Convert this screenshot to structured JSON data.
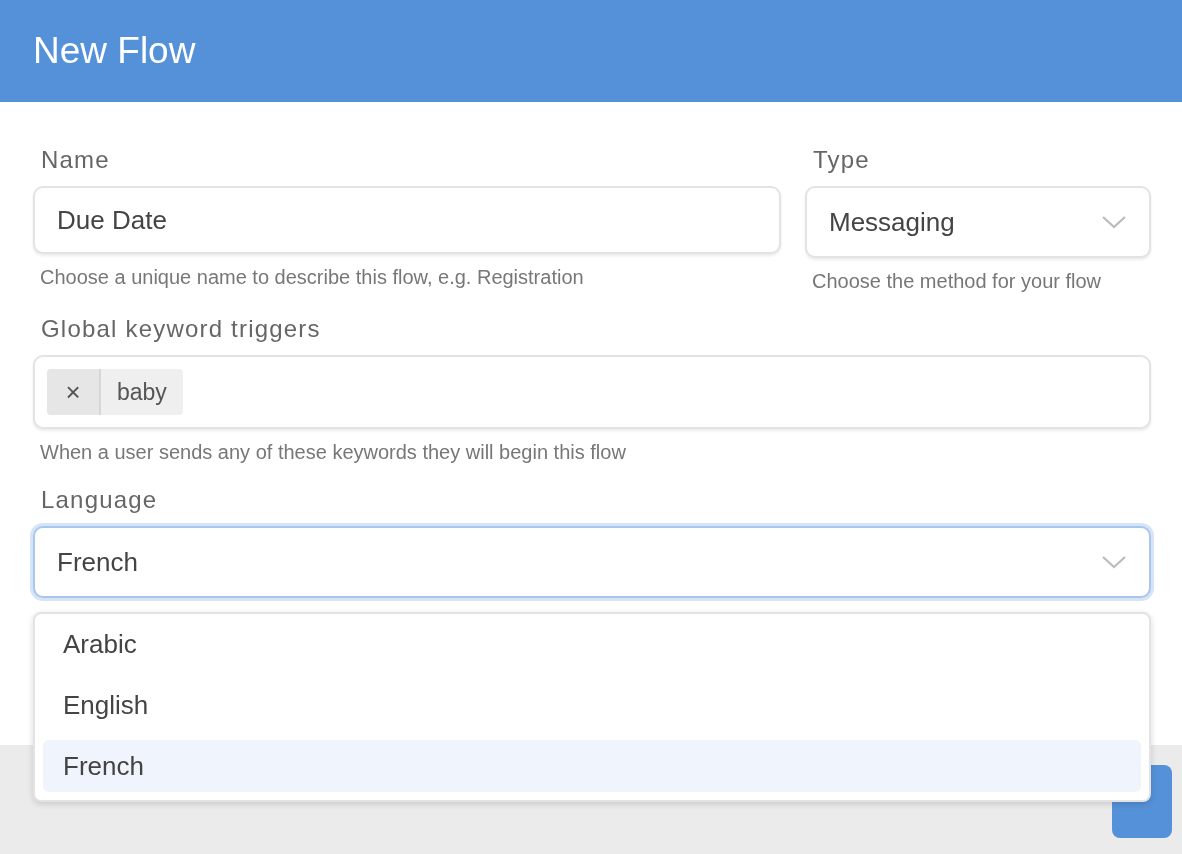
{
  "window": {
    "title": "New Flow"
  },
  "name_field": {
    "label": "Name",
    "value": "Due Date",
    "hint": "Choose a unique name to describe this flow, e.g. Registration"
  },
  "type_field": {
    "label": "Type",
    "value": "Messaging",
    "hint": "Choose the method for your flow"
  },
  "keywords_field": {
    "label": "Global keyword triggers",
    "tags": [
      {
        "remove": "×",
        "text": "baby"
      }
    ],
    "hint": "When a user sends any of these keywords they will begin this flow"
  },
  "language_field": {
    "label": "Language",
    "value": "French",
    "open": true,
    "options": [
      {
        "label": "Arabic",
        "selected": false
      },
      {
        "label": "English",
        "selected": false
      },
      {
        "label": "French",
        "selected": true
      }
    ]
  }
}
